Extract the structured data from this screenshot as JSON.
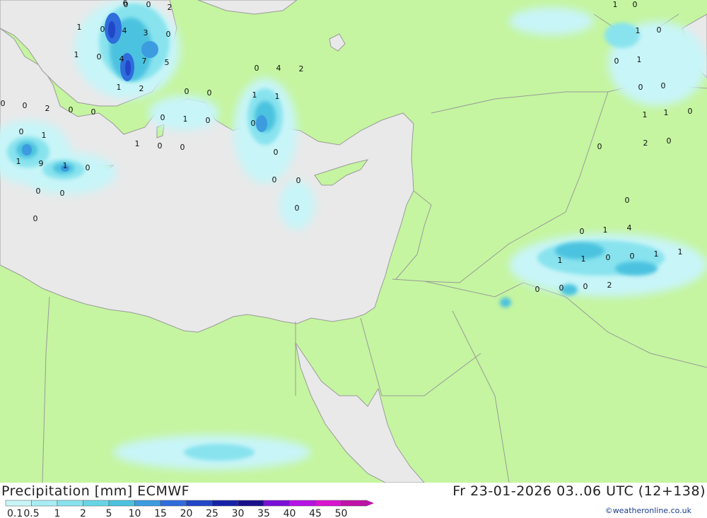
{
  "header": {
    "title": "Precipitation [mm] ECMWF",
    "validity": "Fr 23-01-2026 03..06 UTC (12+138)",
    "credit": "©weatheronline.co.uk"
  },
  "legend": {
    "levels": [
      "0.1",
      "0.5",
      "1",
      "2",
      "5",
      "10",
      "15",
      "20",
      "25",
      "30",
      "35",
      "40",
      "45",
      "50"
    ],
    "colors": [
      "#c8f5f8",
      "#a8edf3",
      "#88e3ee",
      "#66d6e6",
      "#4cc2df",
      "#3d9be0",
      "#2f6cdc",
      "#2246c8",
      "#1522a8",
      "#1a0f8a",
      "#7a10d8",
      "#b612e6",
      "#d814d0",
      "#c012a8"
    ]
  },
  "colors": {
    "land": "#c5f5a0",
    "sea": "#e9e9e9",
    "border": "#9a9a9a"
  },
  "map_labels": [
    "0",
    "0",
    "2",
    "1",
    "0",
    "4",
    "3",
    "0",
    "6",
    "1",
    "0",
    "4",
    "7",
    "5",
    "1",
    "2",
    "0",
    "0",
    "2",
    "0",
    "0",
    "0",
    "0",
    "0",
    "1",
    "0",
    "0",
    "1",
    "1",
    "0",
    "0",
    "1",
    "9",
    "1",
    "0",
    "0",
    "0",
    "0",
    "0",
    "4",
    "2",
    "1",
    "1",
    "0",
    "0",
    "0",
    "0",
    "0",
    "1",
    "0",
    "1",
    "0",
    "0",
    "1",
    "0",
    "0",
    "1",
    "1",
    "0",
    "0",
    "2",
    "0",
    "0",
    "0",
    "1",
    "4",
    "1",
    "1",
    "0",
    "0",
    "1",
    "1",
    "0",
    "0",
    "0",
    "2"
  ]
}
